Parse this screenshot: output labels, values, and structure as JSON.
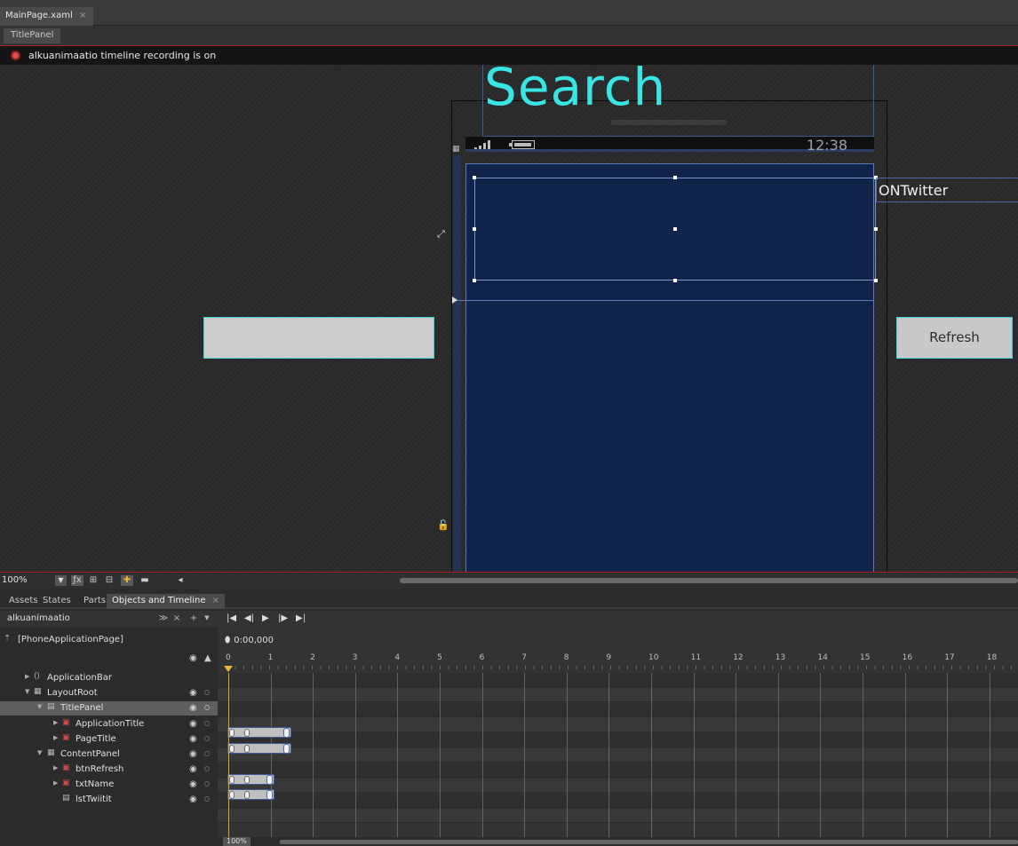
{
  "document_tab": {
    "label": "MainPage.xaml",
    "close": "×"
  },
  "breadcrumb": {
    "label": "TitlePanel"
  },
  "recording": {
    "text": "alkuanimaatio timeline recording is on"
  },
  "artboard": {
    "page_title": "Search",
    "clock": "12:38",
    "twitter_label": "ONTwitter",
    "refresh_label": "Refresh"
  },
  "toolbar": {
    "zoom": "100%"
  },
  "panel_tabs": [
    {
      "label": "Assets"
    },
    {
      "label": "States"
    },
    {
      "label": "Parts"
    },
    {
      "label": "Objects and Timeline",
      "close": "×",
      "active": true
    }
  ],
  "storyboard": {
    "name": "alkuanimaatio"
  },
  "objects": {
    "page": "[PhoneApplicationPage]",
    "tree": [
      {
        "label": "ApplicationBar",
        "depth": 1,
        "expander": "▶",
        "icon": "code-icon"
      },
      {
        "label": "LayoutRoot",
        "depth": 1,
        "expander": "▼",
        "icon": "grid-icon"
      },
      {
        "label": "TitlePanel",
        "depth": 2,
        "expander": "▼",
        "icon": "panel-icon",
        "selected": true
      },
      {
        "label": "ApplicationTitle",
        "depth": 3,
        "expander": "▶",
        "icon": "textblock-icon",
        "animated": true
      },
      {
        "label": "PageTitle",
        "depth": 3,
        "expander": "▶",
        "icon": "textblock-icon",
        "animated": true
      },
      {
        "label": "ContentPanel",
        "depth": 2,
        "expander": "▼",
        "icon": "grid-icon"
      },
      {
        "label": "btnRefresh",
        "depth": 3,
        "expander": "▶",
        "icon": "button-icon",
        "animated": true
      },
      {
        "label": "txtName",
        "depth": 3,
        "expander": "▶",
        "icon": "textbox-icon",
        "animated": true
      },
      {
        "label": "lstTwiitit",
        "depth": 3,
        "expander": "",
        "icon": "listbox-icon"
      }
    ]
  },
  "timeline": {
    "time": "0:00,000",
    "zoom": "100%",
    "ticks": [
      "0",
      "1",
      "2",
      "3",
      "4",
      "5",
      "6",
      "7",
      "8",
      "9",
      "10",
      "11",
      "12",
      "13",
      "14",
      "15",
      "16",
      "17",
      "18"
    ]
  },
  "colors": {
    "accent_title": "#39e4e4",
    "page_background": "#0f2448",
    "recording": "#e34a4a",
    "playhead": "#d7a82a"
  }
}
